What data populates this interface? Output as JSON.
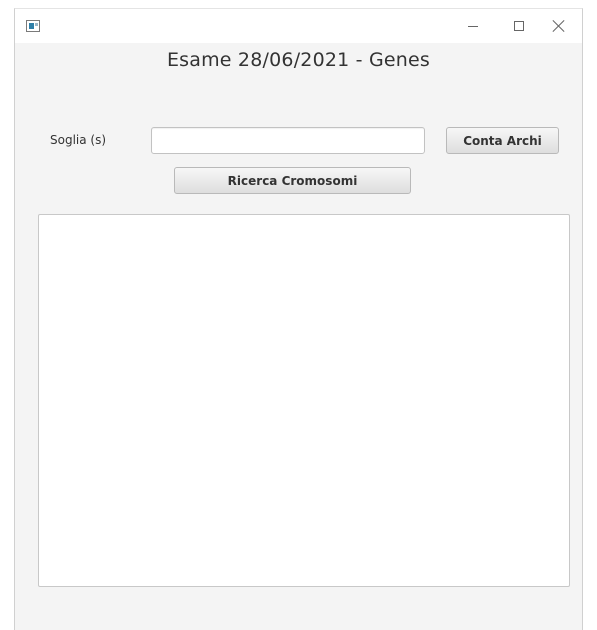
{
  "window": {
    "title": "",
    "controls": {
      "minimize_icon": "minimize-icon",
      "maximize_icon": "maximize-icon",
      "close_icon": "close-icon"
    }
  },
  "header": {
    "title": "Esame 28/06/2021 - Genes"
  },
  "form": {
    "soglia_label": "Soglia (s)",
    "soglia_value": "",
    "soglia_placeholder": "",
    "conta_archi_label": "Conta Archi",
    "ricerca_cromosomi_label": "Ricerca Cromosomi"
  },
  "output": {
    "text": ""
  },
  "colors": {
    "window_background": "#f4f4f4",
    "titlebar_background": "#ffffff",
    "button_gradient_top": "#f7f7f7",
    "button_gradient_bottom": "#dedede",
    "text": "#333333"
  }
}
